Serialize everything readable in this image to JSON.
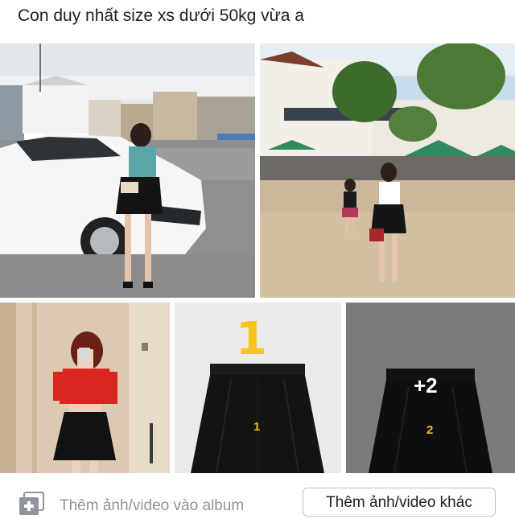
{
  "post": {
    "caption": "Con duy nhất size xs dưới 50kg vừa a"
  },
  "photos": {
    "skirt1": {
      "number_label": "1",
      "overlay_number": "1"
    },
    "skirt2": {
      "number_label": "2",
      "more_count": "+2"
    }
  },
  "actions": {
    "add_media_label": "Thêm ảnh/video vào album",
    "add_other_label": "Thêm ảnh/video khác",
    "add_media_icon": "photo-plus-icon"
  }
}
